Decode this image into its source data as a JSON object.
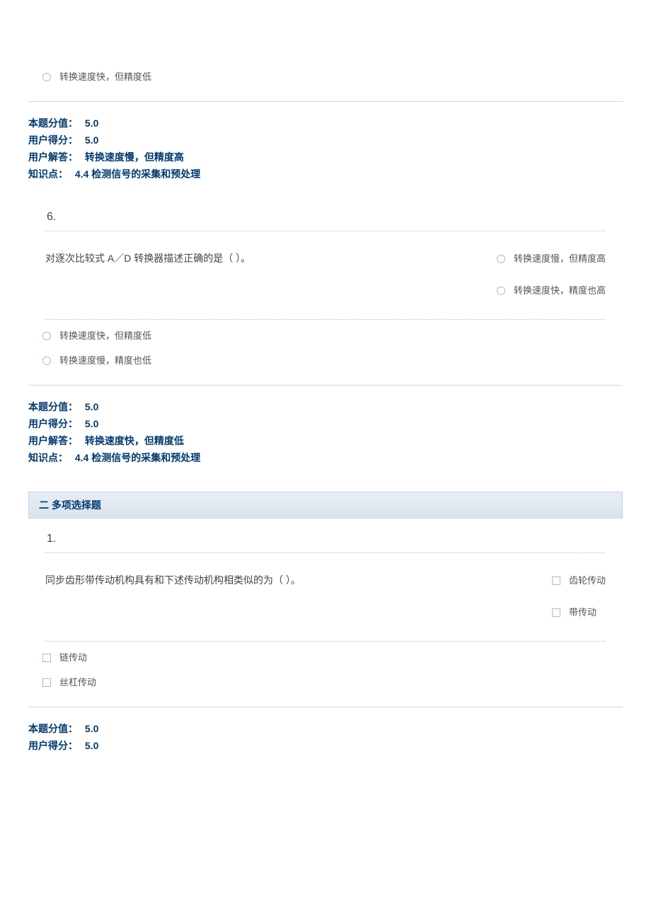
{
  "q5_tail": {
    "opt_d": "转换速度快，但精度低",
    "score_label": "本题分值：",
    "score_value": "5.0",
    "user_score_label": "用户得分：",
    "user_score_value": "5.0",
    "user_answer_label": "用户解答：",
    "user_answer_value": "转换速度慢，但精度高",
    "kp_label": "知识点：",
    "kp_value": "4.4  检测信号的采集和预处理"
  },
  "q6": {
    "number": "6.",
    "text": "对逐次比较式 A／D 转换器描述正确的是（  ）。",
    "opt_a": "转换速度慢，但精度高",
    "opt_b": "转换速度快，精度也高",
    "opt_c": "转换速度快，但精度低",
    "opt_d": "转换速度慢，精度也低",
    "score_label": "本题分值：",
    "score_value": "5.0",
    "user_score_label": "用户得分：",
    "user_score_value": "5.0",
    "user_answer_label": "用户解答：",
    "user_answer_value": "转换速度快，但精度低",
    "kp_label": "知识点：",
    "kp_value": "4.4  检测信号的采集和预处理"
  },
  "section2": {
    "title": "二  多项选择题"
  },
  "m1": {
    "number": "1.",
    "text": "同步齿形带传动机构具有和下述传动机构相类似的为（  ）。",
    "opt_a": "齿轮传动",
    "opt_b": "带传动",
    "opt_c": "链传动",
    "opt_d": "丝杠传动",
    "score_label": "本题分值：",
    "score_value": "5.0",
    "user_score_label": "用户得分：",
    "user_score_value": "5.0"
  }
}
